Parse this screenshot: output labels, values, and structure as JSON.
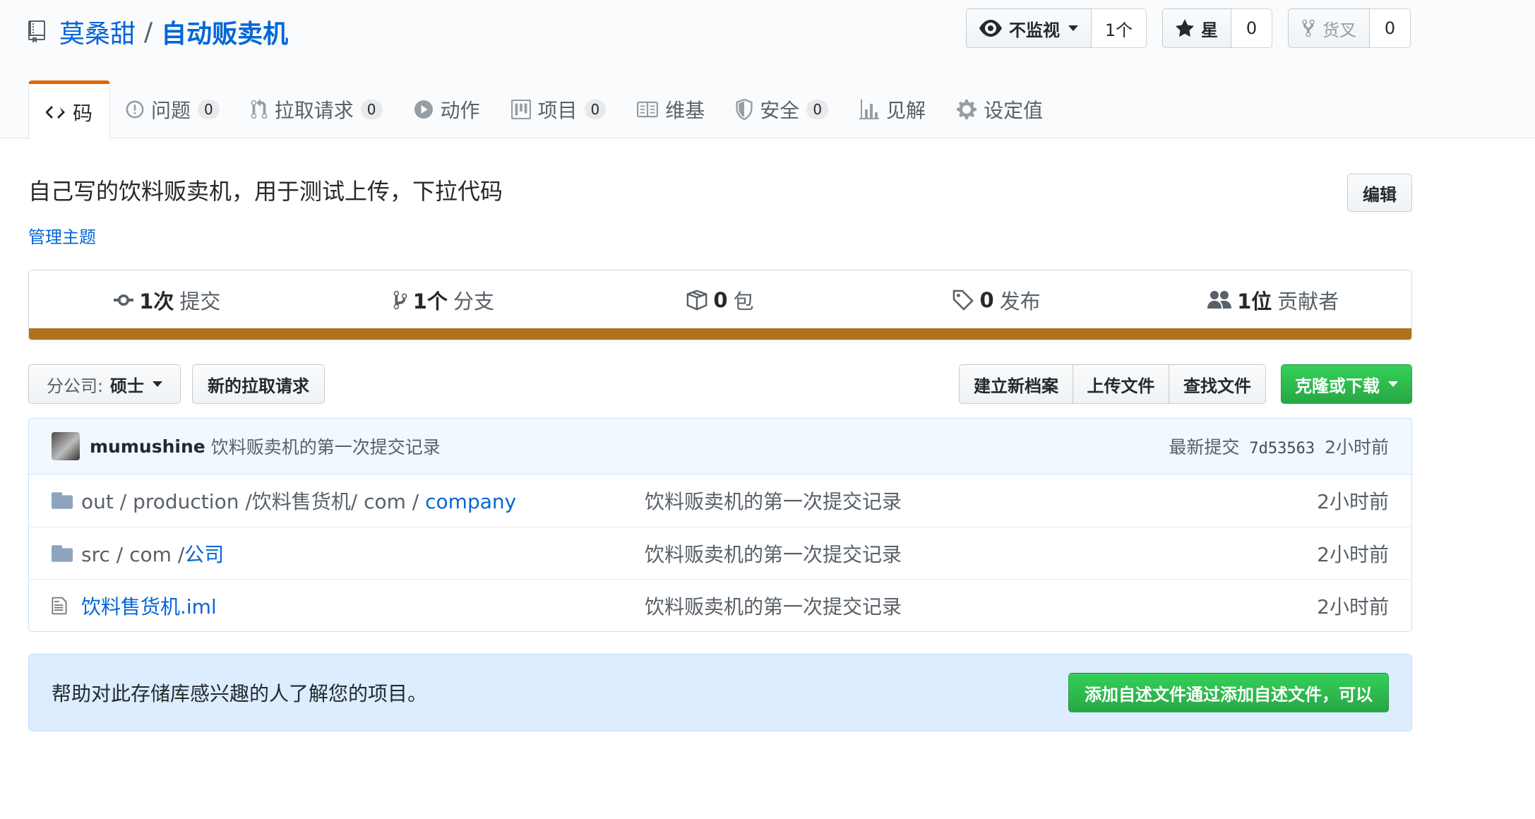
{
  "repo": {
    "owner": "莫桑甜",
    "separator": "/",
    "name": "自动贩卖机"
  },
  "actions": {
    "watch_label": "不监视",
    "watch_count": "1个",
    "star_label": "星",
    "star_count": "0",
    "fork_label": "货叉",
    "fork_count": "0"
  },
  "nav": {
    "code": "码",
    "issues": "问题",
    "issues_count": "0",
    "pulls": "拉取请求",
    "pulls_count": "0",
    "actions": "动作",
    "projects": "项目",
    "projects_count": "0",
    "wiki": "维基",
    "security": "安全",
    "security_count": "0",
    "insights": "见解",
    "settings": "设定值"
  },
  "about": {
    "description": "自己写的饮料贩卖机，用于测试上传，下拉代码",
    "manage_topics": "管理主题",
    "edit": "编辑"
  },
  "summary": {
    "commits_num": "1次",
    "commits_label": "提交",
    "branches_num": "1个",
    "branches_label": "分支",
    "packages_num": "0",
    "packages_label": "包",
    "releases_num": "0",
    "releases_label": "发布",
    "contributors_num": "1位",
    "contributors_label": "贡献者",
    "lang_color": "#b07219"
  },
  "file_nav": {
    "branch_label": "分公司:",
    "branch_value": "硕士",
    "new_pr": "新的拉取请求",
    "create_file": "建立新档案",
    "upload_files": "上传文件",
    "find_file": "查找文件",
    "clone": "克隆或下载"
  },
  "commit": {
    "author": "mumushine",
    "message": "饮料贩卖机的第一次提交记录",
    "latest_label": "最新提交",
    "sha": "7d53563",
    "age": "2小时前"
  },
  "files": [
    {
      "path_prefix": "out / production /饮料售货机/ com / ",
      "path_link": "company",
      "message": "饮料贩卖机的第一次提交记录",
      "age": "2小时前"
    },
    {
      "path_prefix": "src / com /",
      "path_link": "公司",
      "message": "饮料贩卖机的第一次提交记录",
      "age": "2小时前"
    },
    {
      "path_prefix": "",
      "path_link": "饮料售货机.iml",
      "message": "饮料贩卖机的第一次提交记录",
      "age": "2小时前"
    }
  ],
  "readme": {
    "prompt": "帮助对此存储库感兴趣的人了解您的项目。",
    "button": "添加自述文件通过添加自述文件，可以"
  }
}
